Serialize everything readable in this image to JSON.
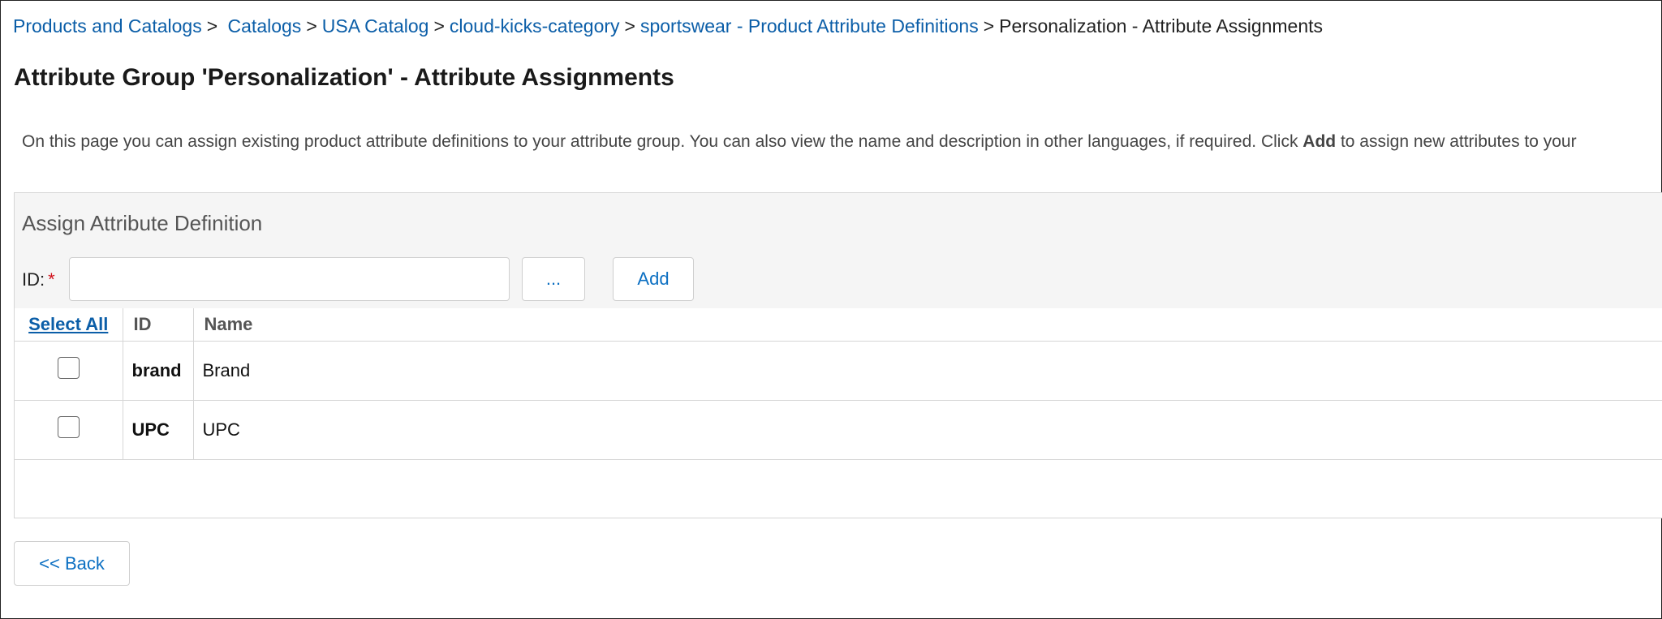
{
  "breadcrumb": {
    "items": [
      {
        "label": "Products and Catalogs"
      },
      {
        "label": "Catalogs"
      },
      {
        "label": "USA Catalog"
      },
      {
        "label": "cloud-kicks-category"
      },
      {
        "label": "sportswear - Product Attribute Definitions"
      }
    ],
    "separator": ">",
    "current": "Personalization - Attribute Assignments"
  },
  "page": {
    "title": "Attribute Group 'Personalization' - Attribute Assignments",
    "description_before": "On this page you can assign existing product attribute definitions to your attribute group. You can also view the name and description in other languages, if required. Click ",
    "description_bold": "Add",
    "description_after": " to assign new attributes to your"
  },
  "assign_panel": {
    "title": "Assign Attribute Definition",
    "id_label": "ID:",
    "required_marker": "*",
    "id_value": "",
    "browse_label": "...",
    "add_label": "Add"
  },
  "table": {
    "headers": {
      "select_all": "Select All",
      "id": "ID",
      "name": "Name"
    },
    "rows": [
      {
        "checked": false,
        "id": "brand",
        "name": "Brand"
      },
      {
        "checked": false,
        "id": "UPC",
        "name": "UPC"
      }
    ]
  },
  "footer": {
    "back_label": "<< Back"
  },
  "colors": {
    "link": "#0b5ea8",
    "button_text": "#0b6fc2",
    "required": "#d0101a",
    "panel_header_bg": "#f5f5f5"
  }
}
